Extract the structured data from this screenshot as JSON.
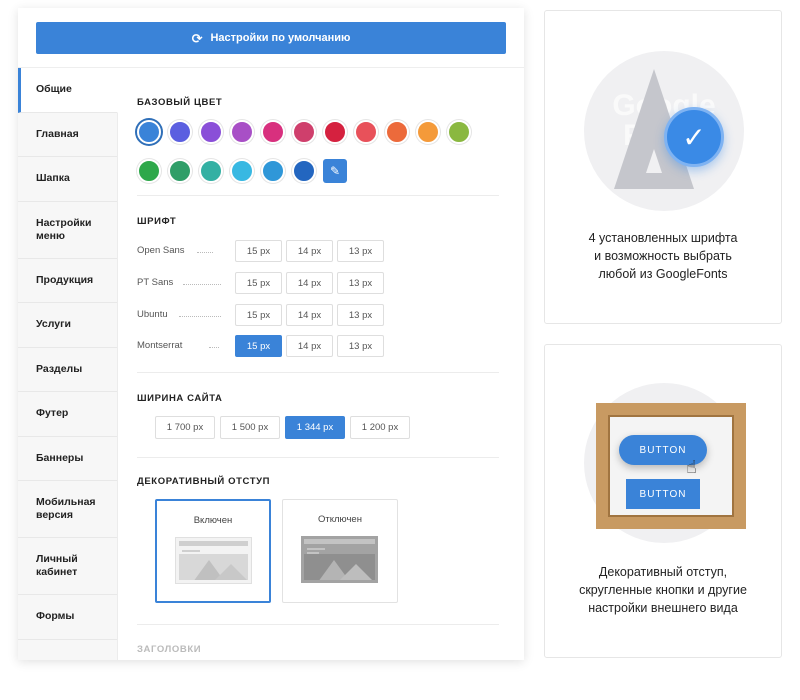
{
  "reset_button": {
    "icon": "⟳",
    "label": "Настройки по умолчанию"
  },
  "sidebar": {
    "items": [
      {
        "label": "Общие",
        "active": true
      },
      {
        "label": "Главная"
      },
      {
        "label": "Шапка"
      },
      {
        "label": "Настройки\nменю"
      },
      {
        "label": "Продукция"
      },
      {
        "label": "Услуги"
      },
      {
        "label": "Разделы"
      },
      {
        "label": "Футер"
      },
      {
        "label": "Баннеры"
      },
      {
        "label": "Мобильная\nверсия"
      },
      {
        "label": "Личный\nкабинет"
      },
      {
        "label": "Формы"
      }
    ]
  },
  "base_color": {
    "title": "БАЗОВЫЙ ЦВЕТ",
    "selected": "#3a83d8",
    "row1": [
      "#3a83d8",
      "#5b5fe0",
      "#8a4fd8",
      "#a84fc6",
      "#d8307e",
      "#cf3f6c",
      "#d5213f",
      "#e8515a",
      "#ec6a3b",
      "#f49a3a",
      "#8ab840"
    ],
    "row2": [
      "#2ea84a",
      "#2f9e68",
      "#33b0a3",
      "#38b8e2",
      "#2f97d8",
      "#2366c0"
    ],
    "picker_icon": "✎"
  },
  "font": {
    "title": "ШРИФТ",
    "rows": [
      {
        "name": "Open Sans",
        "sizes": [
          "15 px",
          "14 px",
          "13 px"
        ],
        "active": -1
      },
      {
        "name": "PT Sans",
        "sizes": [
          "15 px",
          "14 px",
          "13 px"
        ],
        "active": -1
      },
      {
        "name": "Ubuntu",
        "sizes": [
          "15 px",
          "14 px",
          "13 px"
        ],
        "active": -1
      },
      {
        "name": "Montserrat",
        "sizes": [
          "15 px",
          "14 px",
          "13 px"
        ],
        "active": 0
      }
    ]
  },
  "site_width": {
    "title": "ШИРИНА САЙТА",
    "options": [
      "1 700 px",
      "1 500 px",
      "1 344 px",
      "1 200 px"
    ],
    "active": 2
  },
  "decorative": {
    "title": "ДЕКОРАТИВНЫЙ ОТСТУП",
    "on_label": "Включен",
    "off_label": "Отключен"
  },
  "headings": {
    "title": "ЗАГОЛОВКИ"
  },
  "promo_fonts": {
    "bg_text": "Google\nFonts",
    "check_icon": "✓",
    "text": "4 установленных шрифта\nи возможность выбрать\nлюбой из GoogleFonts"
  },
  "promo_buttons": {
    "pill_label": "BUTTON",
    "square_label": "BUTTON",
    "cursor_icon": "☝",
    "text": "Декоративный отступ,\nскругленные кнопки и другие\nнастройки внешнего вида"
  }
}
